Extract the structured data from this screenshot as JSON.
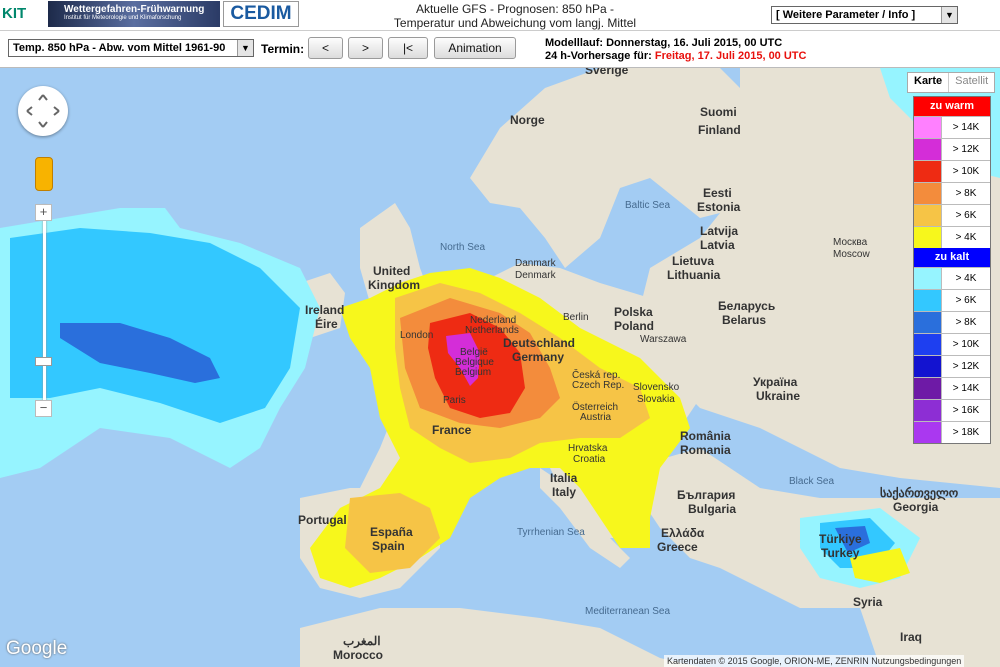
{
  "header": {
    "kit_logo": "KIT",
    "banner_title": "Wettergefahren-Frühwarnung",
    "banner_subtitle": "Institut für Meteorologie und Klimaforschung",
    "cedim_logo": "CEDIM",
    "title_line1": "Aktuelle GFS - Prognosen: 850 hPa -",
    "title_line2": "Temperatur und Abweichung vom langj. Mittel",
    "params_select": "[ Weitere Parameter / Info ]"
  },
  "toolbar": {
    "param_select": "Temp. 850 hPa - Abw. vom Mittel 1961-90",
    "termin_label": "Termin:",
    "prev_label": "<",
    "next_label": ">",
    "first_label": "|<",
    "animation_label": "Animation",
    "model_run": "Modelllauf: Donnerstag, 16. Juli 2015, 00 UTC",
    "forecast_prefix": "24 h-Vorhersage für:",
    "forecast_value": "Freitag, 17. Juli 2015, 00 UTC"
  },
  "map_type": {
    "karte": "Karte",
    "satellit": "Satellit"
  },
  "legend": {
    "warm_title": "zu warm",
    "warm_color": "#ff0000",
    "warm": [
      {
        "label": "> 14K",
        "color": "#ff80ff"
      },
      {
        "label": "> 12K",
        "color": "#d42dd8"
      },
      {
        "label": "> 10K",
        "color": "#ee2b13"
      },
      {
        "label": "> 8K",
        "color": "#f38c3c"
      },
      {
        "label": "> 6K",
        "color": "#f6c446"
      },
      {
        "label": "> 4K",
        "color": "#f7f71c"
      }
    ],
    "cold_title": "zu kalt",
    "cold_color": "#0000ff",
    "cold": [
      {
        "label": "> 4K",
        "color": "#96f4ff"
      },
      {
        "label": "> 6K",
        "color": "#33c8ff"
      },
      {
        "label": "> 8K",
        "color": "#2a6fdc"
      },
      {
        "label": "> 10K",
        "color": "#1e3ff0"
      },
      {
        "label": "> 12K",
        "color": "#1313d0"
      },
      {
        "label": "> 14K",
        "color": "#6e1aa6"
      },
      {
        "label": "> 16K",
        "color": "#8d2ed4"
      },
      {
        "label": "> 18K",
        "color": "#aa38f0"
      }
    ]
  },
  "map_labels": {
    "sverige": "Sverige",
    "norge": "Norge",
    "suomi": "Suomi",
    "finland": "Finland",
    "eesti": "Eesti",
    "estonia": "Estonia",
    "baltic_sea": "Baltic Sea",
    "north_sea": "North Sea",
    "latvija": "Latvija",
    "latvia": "Latvia",
    "moskva": "Москва",
    "moscow": "Moscow",
    "denmark1": "Danmark",
    "denmark2": "Denmark",
    "lietuva": "Lietuva",
    "lithuania": "Lithuania",
    "united_kingdom1": "United",
    "united_kingdom2": "Kingdom",
    "ireland": "Ireland",
    "eire": "Éire",
    "london": "London",
    "nederland": "Nederland",
    "netherlands": "Netherlands",
    "berlin": "Berlin",
    "polska": "Polska",
    "poland": "Poland",
    "belarus1": "Беларусь",
    "belarus2": "Belarus",
    "warszawa": "Warszawa",
    "deutschland": "Deutschland",
    "germany": "Germany",
    "belgie": "België",
    "belgique": "Belgique",
    "belgium": "Belgium",
    "paris": "Paris",
    "cesko": "Česká rep.",
    "czech": "Czech Rep.",
    "slovensko": "Slovensko",
    "slovakia": "Slovakia",
    "ukraina": "Україна",
    "ukraine": "Ukraine",
    "osterreich": "Österreich",
    "austria": "Austria",
    "france": "France",
    "romania1": "România",
    "romania2": "Romania",
    "hrvatska": "Hrvatska",
    "croatia": "Croatia",
    "black_sea": "Black Sea",
    "portugal": "Portugal",
    "espana": "España",
    "spain": "Spain",
    "italia": "Italia",
    "italy": "Italy",
    "bulgaria1": "България",
    "bulgaria2": "Bulgaria",
    "georgia1": "საქართველო",
    "georgia2": "Georgia",
    "ellada": "Ελλάδα",
    "greece": "Greece",
    "tyrrhenian": "Tyrrhenian Sea",
    "turkiye": "Türkiye",
    "turkey": "Turkey",
    "mediterranean": "Mediterranean Sea",
    "syria": "Syria",
    "iraq": "Iraq",
    "maghreb": "المغرب",
    "morocco": "Morocco"
  },
  "controls": {
    "zoom_in": "+",
    "zoom_out": "−"
  },
  "footer": {
    "google": "Google",
    "attribution": "Kartendaten © 2015 Google, ORION-ME, ZENRIN   Nutzungsbedingungen"
  }
}
